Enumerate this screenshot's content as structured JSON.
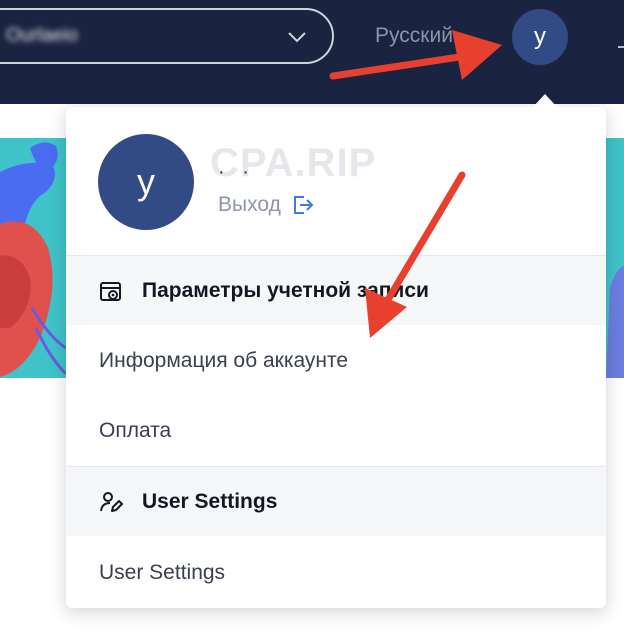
{
  "navbar": {
    "workspace_select": {
      "name": "Ourlaeio",
      "chevron_icon": "chevron-down-icon"
    },
    "language": "Русский",
    "avatar_letter": "y"
  },
  "dropdown": {
    "profile": {
      "avatar_letter": "y",
      "name": "· ·",
      "logout_label": "Выход",
      "logout_icon": "logout-arrow-icon"
    },
    "watermark": "CPA.RIP",
    "account_section": {
      "title": "Параметры учетной записи",
      "icon": "account-settings-icon",
      "items": [
        {
          "label": "Информация об аккаунте"
        },
        {
          "label": "Оплата"
        }
      ]
    },
    "user_section": {
      "title": "User Settings",
      "icon": "user-edit-icon",
      "items": [
        {
          "label": "User Settings"
        }
      ]
    }
  },
  "annotations": {
    "arrow_color": "#e8402f"
  },
  "colors": {
    "navbar_bg": "#1a2340",
    "avatar_bg": "#324a86",
    "banner": "#3fc3c9"
  }
}
